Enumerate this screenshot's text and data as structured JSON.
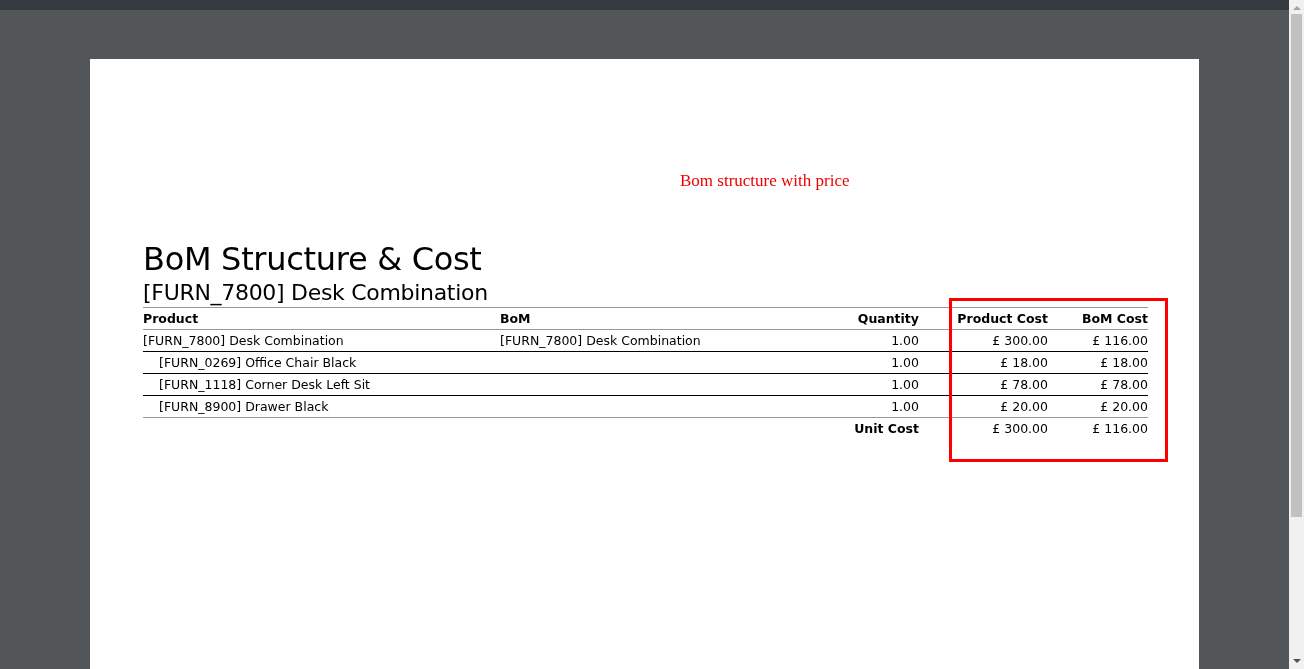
{
  "annotation": "Bom structure with price",
  "report": {
    "title": "BoM Structure & Cost",
    "subtitle": "[FURN_7800] Desk Combination",
    "columns": [
      "Product",
      "BoM",
      "Quantity",
      "Product Cost",
      "BoM Cost"
    ],
    "rows": [
      {
        "product": "[FURN_7800] Desk Combination",
        "bom": "[FURN_7800] Desk Combination",
        "quantity": "1.00",
        "product_cost": "£ 300.00",
        "bom_cost": "£ 116.00",
        "children": [
          {
            "product": "[FURN_0269] Office Chair Black",
            "quantity": "1.00",
            "product_cost": "£ 18.00",
            "bom_cost": "£ 18.00"
          },
          {
            "product": "[FURN_1118] Corner Desk Left Sit",
            "quantity": "1.00",
            "product_cost": "£ 78.00",
            "bom_cost": "£ 78.00"
          },
          {
            "product": "[FURN_8900] Drawer Black",
            "quantity": "1.00",
            "product_cost": "£ 20.00",
            "bom_cost": "£ 20.00"
          }
        ]
      }
    ],
    "footer": {
      "label": "Unit Cost",
      "product_cost": "£ 300.00",
      "bom_cost": "£ 116.00"
    }
  }
}
